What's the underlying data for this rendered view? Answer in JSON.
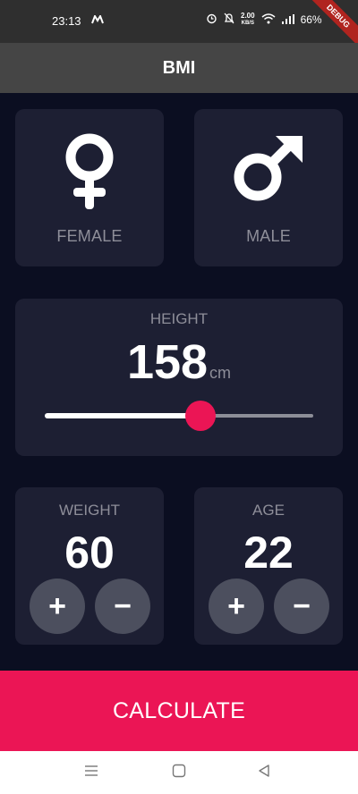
{
  "status_bar": {
    "time": "23:13",
    "network_speed": "2.00",
    "network_unit": "KB/S",
    "battery": "66%",
    "debug_label": "DEBUG"
  },
  "app_bar": {
    "title": "BMI"
  },
  "gender": {
    "female_label": "FEMALE",
    "male_label": "MALE"
  },
  "height": {
    "label": "HEIGHT",
    "value": "158",
    "unit": "cm",
    "slider_fraction": 0.58
  },
  "weight": {
    "label": "WEIGHT",
    "value": "60",
    "plus": "+",
    "minus": "−"
  },
  "age": {
    "label": "AGE",
    "value": "22",
    "plus": "+",
    "minus": "−"
  },
  "calculate_label": "CALCULATE",
  "colors": {
    "background": "#0b0e21",
    "card": "#1d1f33",
    "accent": "#eb1555",
    "round_button": "#4c4f5e"
  },
  "icons": {
    "female": "female-symbol-icon",
    "male": "male-symbol-icon",
    "nav_menu": "menu-lines-icon",
    "nav_home": "square-icon",
    "nav_back": "triangle-back-icon"
  }
}
